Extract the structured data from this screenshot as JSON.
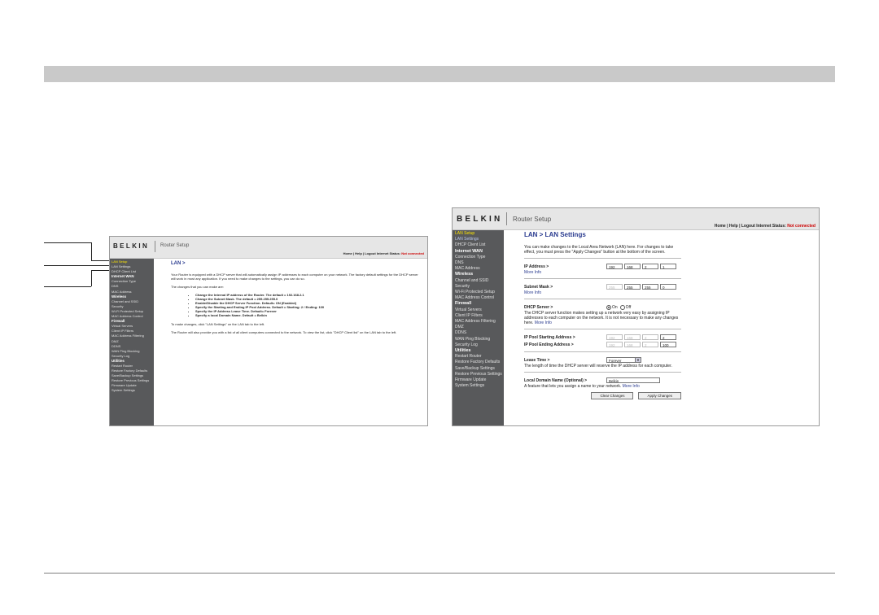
{
  "left_shot": {
    "logo": "BELKIN",
    "title": "Router Setup",
    "status_prefix": "Home | Help | Logout  Internet Status: ",
    "status_value": "Not connected",
    "sidebar": [
      {
        "label": "LAN Setup",
        "kind": "active"
      },
      {
        "label": "LAN Settings",
        "kind": "item"
      },
      {
        "label": "DHCP Client List",
        "kind": "item"
      },
      {
        "label": "Internet WAN",
        "kind": "sec"
      },
      {
        "label": "Connection Type",
        "kind": "item"
      },
      {
        "label": "DNS",
        "kind": "item"
      },
      {
        "label": "MAC Address",
        "kind": "item"
      },
      {
        "label": "Wireless",
        "kind": "sec"
      },
      {
        "label": "Channel and SSID",
        "kind": "item"
      },
      {
        "label": "Security",
        "kind": "item"
      },
      {
        "label": "Wi-Fi Protected Setup",
        "kind": "item"
      },
      {
        "label": "MAC Address Control",
        "kind": "item"
      },
      {
        "label": "Firewall",
        "kind": "sec"
      },
      {
        "label": "Virtual Servers",
        "kind": "item"
      },
      {
        "label": "Client IP Filters",
        "kind": "item"
      },
      {
        "label": "MAC Address Filtering",
        "kind": "item"
      },
      {
        "label": "DMZ",
        "kind": "item"
      },
      {
        "label": "DDNS",
        "kind": "item"
      },
      {
        "label": "WAN Ping Blocking",
        "kind": "item"
      },
      {
        "label": "Security Log",
        "kind": "item"
      },
      {
        "label": "Utilities",
        "kind": "sec"
      },
      {
        "label": "Restart Router",
        "kind": "item"
      },
      {
        "label": "Restore Factory Defaults",
        "kind": "item"
      },
      {
        "label": "Save/Backup Settings",
        "kind": "item"
      },
      {
        "label": "Restore Previous Settings",
        "kind": "item"
      },
      {
        "label": "Firmware Update",
        "kind": "item"
      },
      {
        "label": "System Settings",
        "kind": "item"
      }
    ],
    "heading": "LAN >",
    "intro": "Your Router is equipped with a DHCP server that will automatically assign IP addresses to each computer on your network. The factory default settings for the DHCP server will work in most any application. If you need to make changes to the settings, you can do so.",
    "changes_intro": "The changes that you can make are:",
    "bullets": [
      "Change the Internal IP address of the Router. The default = 192.168.2.1",
      "Change the Subnet Mask. The default = 255.255.255.0",
      "Enable/Disable the DHCP Server Function. Default= ON (Enabled)",
      "Specify the Starting and Ending IP Pool Address. Default = Starting: 2 / Ending: 100",
      "Specify the IP Address Lease Time. Default= Forever",
      "Specify a local Domain Name. Default = Belkin"
    ],
    "make_changes": "To make changes, click \"LAN Settings\" on the LAN tab to the left.",
    "client_list": "The Router will also provide you with a list of all client computers connected to the network. To view the list, click \"DHCP Client list\" on the LAN tab to the left."
  },
  "right_shot": {
    "logo": "BELKIN",
    "title": "Router Setup",
    "status_prefix": "Home | Help | Logout  Internet Status: ",
    "status_value": "Not connected",
    "sidebar": [
      {
        "label": "LAN Setup",
        "kind": "active"
      },
      {
        "label": "LAN Settings",
        "kind": "sub"
      },
      {
        "label": "DHCP Client List",
        "kind": "item"
      },
      {
        "label": "Internet WAN",
        "kind": "sec"
      },
      {
        "label": "Connection Type",
        "kind": "item"
      },
      {
        "label": "DNS",
        "kind": "item"
      },
      {
        "label": "MAC Address",
        "kind": "item"
      },
      {
        "label": "Wireless",
        "kind": "sec"
      },
      {
        "label": "Channel and SSID",
        "kind": "item"
      },
      {
        "label": "Security",
        "kind": "item"
      },
      {
        "label": "Wi-Fi Protected Setup",
        "kind": "item"
      },
      {
        "label": "MAC Address Control",
        "kind": "item"
      },
      {
        "label": "Firewall",
        "kind": "sec"
      },
      {
        "label": "Virtual Servers",
        "kind": "item"
      },
      {
        "label": "Client IP Filters",
        "kind": "item"
      },
      {
        "label": "MAC Address Filtering",
        "kind": "item"
      },
      {
        "label": "DMZ",
        "kind": "item"
      },
      {
        "label": "DDNS",
        "kind": "item"
      },
      {
        "label": "WAN Ping Blocking",
        "kind": "item"
      },
      {
        "label": "Security Log",
        "kind": "item"
      },
      {
        "label": "Utilities",
        "kind": "sec"
      },
      {
        "label": "Restart Router",
        "kind": "item"
      },
      {
        "label": "Restore Factory Defaults",
        "kind": "item"
      },
      {
        "label": "Save/Backup Settings",
        "kind": "item"
      },
      {
        "label": "Restore Previous Settings",
        "kind": "item"
      },
      {
        "label": "Firmware Update",
        "kind": "item"
      },
      {
        "label": "System Settings",
        "kind": "item"
      }
    ],
    "heading": "LAN > LAN Settings",
    "intro": "You can make changes to the Local Area Network (LAN) here. For changes to take effect, you must press the \"Apply Changes\" button at the bottom of the screen.",
    "ip_label": "IP Address >",
    "ip": [
      "192",
      "168",
      "2",
      "1"
    ],
    "subnet_label": "Subnet Mask >",
    "subnet": [
      "255",
      "255",
      "255",
      "0"
    ],
    "more_info": "More Info",
    "dhcp_label": "DHCP Server >",
    "on_label": "On",
    "off_label": "Off",
    "dhcp_desc": "The DHCP server function makes setting up a network very easy by assigning IP addresses to each computer on the network. It is not necessary to make any changes here.",
    "pool_start_label": "IP Pool Starting Address >",
    "pool_start": [
      "192",
      "168",
      "2",
      "2"
    ],
    "pool_end_label": "IP Pool Ending Address >",
    "pool_end": [
      "192",
      "168",
      "2",
      "100"
    ],
    "lease_label": "Lease Time >",
    "lease_value": "Forever",
    "lease_desc": "The length of time the DHCP server will reserve the IP address for each computer.",
    "domain_label": "Local Domain Name (Optional) >",
    "domain_value": "Belkin",
    "domain_desc": "A feature that lets you assign a name to your network.",
    "clear_btn": "Clear Changes",
    "apply_btn": "Apply Changes"
  }
}
